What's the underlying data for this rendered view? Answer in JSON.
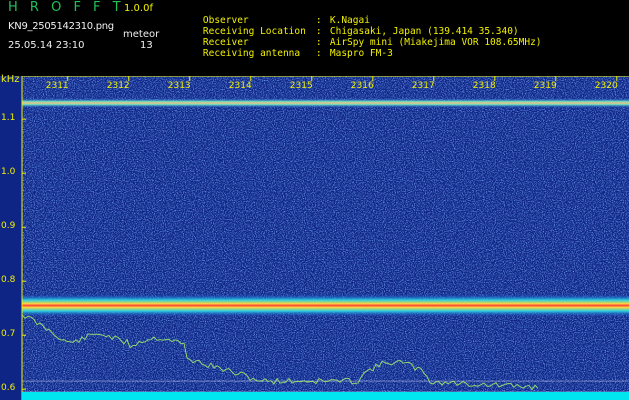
{
  "header": {
    "app_title": "H R O F F T",
    "version": "1.0.0f",
    "filename": "KN9_2505142310.png",
    "meteor_label": "meteor",
    "datetime": "25.05.14 23:10",
    "meteor_count": "13"
  },
  "info": [
    {
      "key": "Observer",
      "value": "K.Nagai"
    },
    {
      "key": "Receiving Location",
      "value": "Chigasaki, Japan (139.414 35.340)"
    },
    {
      "key": "Receiver",
      "value": "AirSpy mini (Miakejima VOR 108.65MHz)"
    },
    {
      "key": "Receiving antenna",
      "value": "Maspro FM-3"
    }
  ],
  "spectrogram": {
    "y_unit": "kHz",
    "y_ticks": [
      "1.1",
      "1.0",
      "0.9",
      "0.8",
      "0.7",
      "0.6"
    ],
    "y_range": [
      0.58,
      1.18
    ],
    "x_ticks": [
      "2311",
      "2312",
      "2313",
      "2314",
      "2315",
      "2316",
      "2317",
      "2318",
      "2319",
      "2320"
    ],
    "signal_bands_khz": [
      1.13,
      0.755
    ],
    "colors": {
      "background": "#102a8a",
      "noise": "#3c6ee0",
      "band_core": "#ff3a3a",
      "band_edge": "#ffd23a",
      "trace": "#9ce86a",
      "axis": "#f2f200",
      "floor": "#00e6f0"
    }
  }
}
